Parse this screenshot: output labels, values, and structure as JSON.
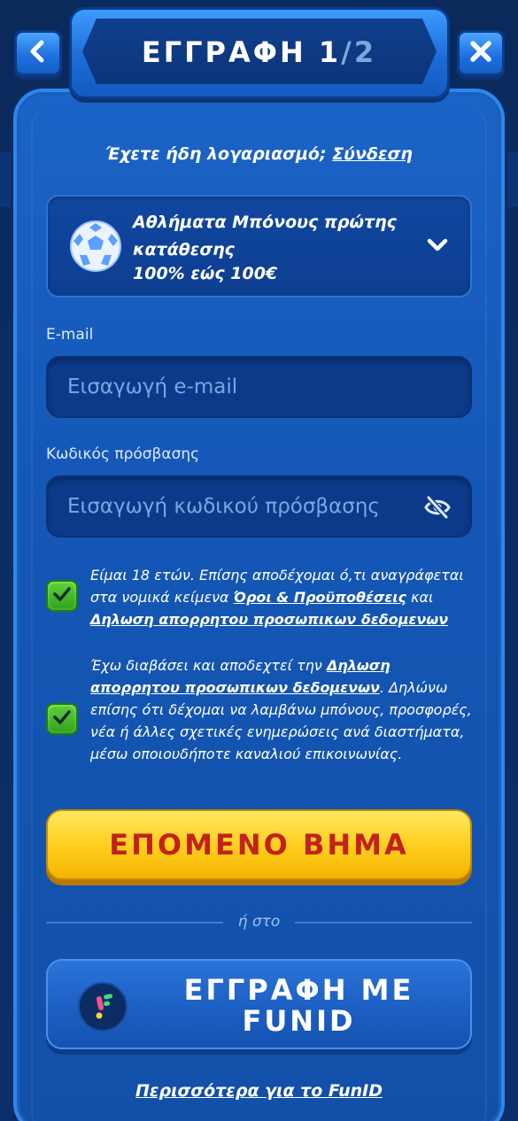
{
  "header": {
    "title_main": "ΕΓΓΡΑΦΗ 1",
    "title_sep_total": "/2",
    "back_icon": "chevron-left-icon",
    "close_icon": "close-icon"
  },
  "login": {
    "prompt": "Έχετε ήδη λογαριασμό;",
    "link": "Σύνδεση"
  },
  "bonus": {
    "title": "Αθλήματα Μπόνους πρώτης κατάθεσης",
    "subtitle": "100% εώς 100€",
    "icon": "soccer-ball-icon",
    "expand_icon": "chevron-down-icon"
  },
  "email": {
    "label": "E-mail",
    "placeholder": "Εισαγωγή e-mail",
    "value": ""
  },
  "password": {
    "label": "Κωδικός πρόσβασης",
    "placeholder": "Εισαγωγή κωδικού πρόσβασης",
    "value": "",
    "toggle_icon": "eye-off-icon"
  },
  "consent1": {
    "checked": true,
    "text_a": "Είμαι 18 ετών. Επίσης αποδέχομαι ό,τι αναγράφεται στα νομικά κείμενα ",
    "link_a": "Όροι & Προϋποθέσεις",
    "text_b": " και ",
    "link_b": "Δηλωση απορρητου προσωπικων δεδομενων"
  },
  "consent2": {
    "checked": true,
    "text_a": "Έχω διαβάσει και αποδεχτεί την ",
    "link_a": "Δηλωση απορρητου προσωπικων δεδομενων",
    "text_b": ". Δηλώνω επίσης ότι δέχομαι να λαμβάνω μπόνους, προσφορές, νέα ή άλλες σχετικές ενημερώσεις ανά διαστήματα, μέσω οποιουδήποτε καναλιού επικοινωνίας."
  },
  "next_button": "ΕΠΟΜΕΝΟ ΒΗΜΑ",
  "divider_text": "ή στο",
  "funid_button": {
    "line1": "ΕΓΓΡΑΦΗ ΜΕ",
    "line2": "FUNID",
    "icon": "funid-logo-icon"
  },
  "more_link": "Περισσότερα για το FunID",
  "colors": {
    "accent_yellow": "#ffcf1f",
    "next_text": "#c2221a",
    "panel_blue": "#1457b6",
    "check_green": "#3fae28"
  }
}
